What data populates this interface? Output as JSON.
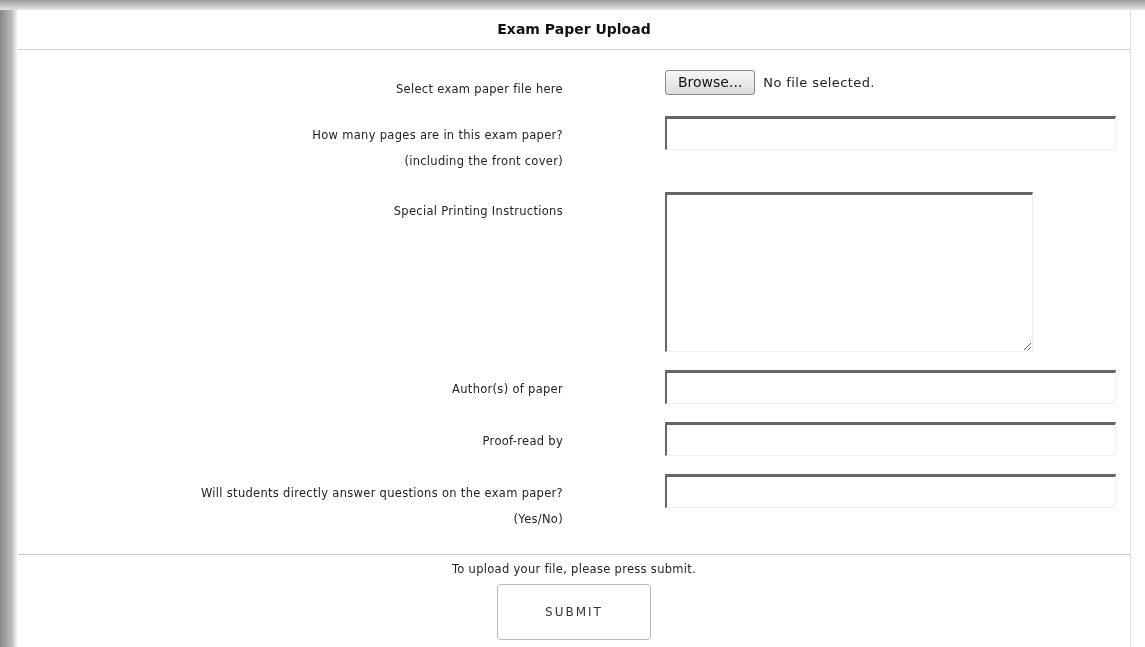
{
  "form_title": "Exam Paper Upload",
  "fields": [
    {
      "kind": "file",
      "label": "Select exam paper file here",
      "button": "Browse...",
      "status": "No file selected."
    },
    {
      "kind": "text",
      "label": "How many pages are in this exam paper?",
      "hint": "(including the front cover)"
    },
    {
      "kind": "textarea",
      "label": "Special Printing Instructions"
    },
    {
      "kind": "text",
      "label": "Author(s) of paper"
    },
    {
      "kind": "text",
      "label": "Proof-read by"
    },
    {
      "kind": "text",
      "label": "Will students directly answer questions on the exam paper?",
      "hint": "(Yes/No)"
    }
  ],
  "footer_note": "To upload your file, please press submit.",
  "submit_button": "SUBMIT"
}
